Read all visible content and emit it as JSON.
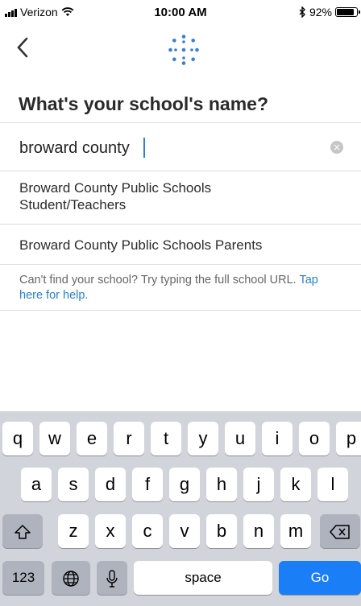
{
  "status_bar": {
    "carrier": "Verizon",
    "time": "10:00 AM",
    "battery": "92%",
    "battery_level": 0.92
  },
  "header": {
    "title": "What's your school's name?"
  },
  "search": {
    "value": "broward county"
  },
  "results": [
    {
      "label": "Broward County Public Schools Student/Teachers"
    },
    {
      "label": "Broward County Public Schools Parents"
    }
  ],
  "help": {
    "text": "Can't find your school? Try typing the full school URL.",
    "link": "Tap here for help."
  },
  "keyboard": {
    "row1": [
      "q",
      "w",
      "e",
      "r",
      "t",
      "y",
      "u",
      "i",
      "o",
      "p"
    ],
    "row2": [
      "a",
      "s",
      "d",
      "f",
      "g",
      "h",
      "j",
      "k",
      "l"
    ],
    "row3": [
      "z",
      "x",
      "c",
      "v",
      "b",
      "n",
      "m"
    ],
    "numbers_label": "123",
    "space_label": "space",
    "go_label": "Go"
  }
}
